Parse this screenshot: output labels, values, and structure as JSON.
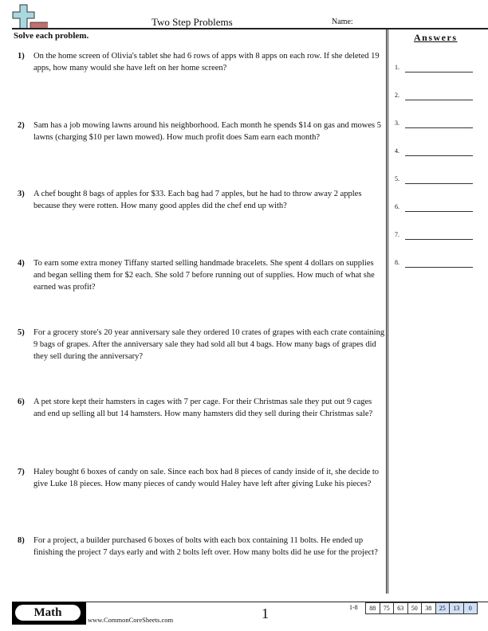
{
  "header": {
    "title": "Two Step Problems",
    "name_label": "Name:",
    "logo_icon": "plus-minus-logo-icon"
  },
  "instructions": "Solve each problem.",
  "answers": {
    "title": "Answers",
    "items": [
      "1.",
      "2.",
      "3.",
      "4.",
      "5.",
      "6.",
      "7.",
      "8."
    ]
  },
  "problems": [
    {
      "num": "1)",
      "text": "On the home screen of Olivia's tablet she had 6 rows of apps with 8 apps on each row. If she deleted 19 apps, how many would she have left on her home screen?"
    },
    {
      "num": "2)",
      "text": "Sam has a job mowing lawns around his neighborhood. Each month he spends $14 on gas and mowes 5 lawns (charging $10 per lawn mowed). How much profit does Sam earn each month?"
    },
    {
      "num": "3)",
      "text": "A chef bought 8 bags of apples for $33. Each bag had 7 apples, but he had to throw away 2 apples because they were rotten. How many good apples did the chef end up with?"
    },
    {
      "num": "4)",
      "text": "To earn some extra money Tiffany started selling handmade bracelets. She spent 4 dollars on supplies and began selling them for $2 each. She sold 7 before running out of supplies. How much of what she earned was profit?"
    },
    {
      "num": "5)",
      "text": "For a grocery store's 20 year anniversary sale they ordered 10 crates of grapes with each crate containing 9 bags of grapes. After the anniversary sale they had sold all but 4 bags. How many bags of grapes did they sell during the anniversary?"
    },
    {
      "num": "6)",
      "text": "A pet store kept their hamsters in cages with 7 per cage. For their Christmas sale they put out 9 cages and end up selling all but 14 hamsters. How many hamsters did they sell during their Christmas sale?"
    },
    {
      "num": "7)",
      "text": "Haley bought 6 boxes of candy on sale. Since each box had 8 pieces of candy inside of it, she decide to give Luke 18 pieces. How many pieces of candy would Haley have left after giving Luke his pieces?"
    },
    {
      "num": "8)",
      "text": "For a project, a builder purchased 6 boxes of bolts with each box containing 11 bolts. He ended up finishing the project 7 days early and with 2 bolts left over. How many bolts did he use for the project?"
    }
  ],
  "footer": {
    "subject": "Math",
    "website": "www.CommonCoreSheets.com",
    "page_number": "1",
    "score_range_label": "1-8",
    "scores": [
      "88",
      "75",
      "63",
      "50",
      "38",
      "25",
      "13",
      "0"
    ],
    "highlight_color": "#cfe0f7"
  }
}
